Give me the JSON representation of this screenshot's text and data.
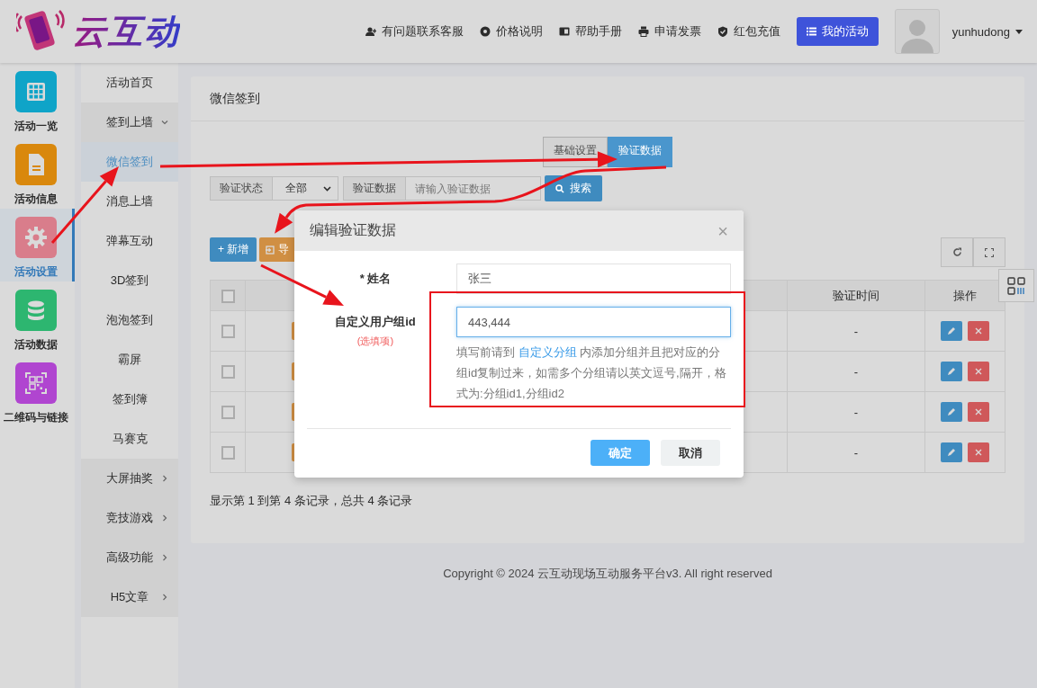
{
  "header": {
    "logo_text": "云互动",
    "links": [
      "有问题联系客服",
      "价格说明",
      "帮助手册",
      "申请发票",
      "红包充值"
    ],
    "primary_button": "我的活动",
    "username": "yunhudong"
  },
  "nav_rail": [
    {
      "label": "活动一览",
      "selected": false,
      "color": "#0fa4c8"
    },
    {
      "label": "活动信息",
      "selected": false,
      "color": "#d9880d"
    },
    {
      "label": "活动设置",
      "selected": true,
      "color": "#d97d8b"
    },
    {
      "label": "活动数据",
      "selected": false,
      "color": "#2db670"
    },
    {
      "label": "二维码与链接",
      "selected": false,
      "color": "#b045d0"
    }
  ],
  "sub_menu": [
    {
      "label": "活动首页",
      "selected": false
    },
    {
      "label": "签到上墙",
      "selected": false,
      "expanded": true,
      "children": [
        {
          "label": "微信签到",
          "selected": true
        },
        {
          "label": "消息上墙",
          "selected": false
        },
        {
          "label": "弹幕互动",
          "selected": false
        },
        {
          "label": "3D签到",
          "selected": false
        },
        {
          "label": "泡泡签到",
          "selected": false
        },
        {
          "label": "霸屏",
          "selected": false
        },
        {
          "label": "签到簿",
          "selected": false
        },
        {
          "label": "马赛克",
          "selected": false
        }
      ]
    },
    {
      "label": "大屏抽奖",
      "selected": false,
      "expanded": false
    },
    {
      "label": "竞技游戏",
      "selected": false,
      "expanded": false
    },
    {
      "label": "高级功能",
      "selected": false,
      "expanded": false
    },
    {
      "label": "H5文章",
      "selected": false,
      "expanded": false
    }
  ],
  "panel": {
    "title": "微信签到",
    "tabs": [
      {
        "label": "基础设置",
        "selected": false
      },
      {
        "label": "验证数据",
        "selected": true
      }
    ],
    "filters": [
      {
        "kind": "select",
        "label": "验证状态",
        "value": "全部"
      },
      {
        "kind": "text",
        "label": "验证数据",
        "placeholder": "请输入验证数据"
      }
    ],
    "search_button": "搜索",
    "toolbar": [
      {
        "kind": "add",
        "label": "+ 新增"
      },
      {
        "kind": "import",
        "label": "导"
      }
    ],
    "table": {
      "header_checked": false,
      "headers": [
        "验证时间",
        "操作"
      ],
      "rows": [
        {
          "checked": false,
          "verify_time": "-"
        },
        {
          "checked": false,
          "verify_time": "-"
        },
        {
          "checked": false,
          "verify_time": "-"
        },
        {
          "checked": false,
          "verify_time": "-"
        }
      ]
    },
    "summary": "显示第 1 到第 4 条记录，总共 4 条记录"
  },
  "footer": "Copyright © 2024 云互动现场互动服务平台v3. All right reserved",
  "modal": {
    "title": "编辑验证数据",
    "close": "×",
    "fields": [
      {
        "label": "* 姓名",
        "value": "张三",
        "focused": false
      },
      {
        "label": "自定义用户组id",
        "note": "(选填项)",
        "value": "443,444",
        "focused": true,
        "hint_before": "填写前请到",
        "hint_link": "自定义分组",
        "hint_after": "内添加分组并且把对应的分组id复制过来，如需多个分组请以英文逗号,隔开，格式为:分组id1,分组id2"
      }
    ],
    "buttons": [
      {
        "kind": "primary",
        "label": "确定"
      },
      {
        "kind": "default",
        "label": "取消"
      }
    ]
  }
}
